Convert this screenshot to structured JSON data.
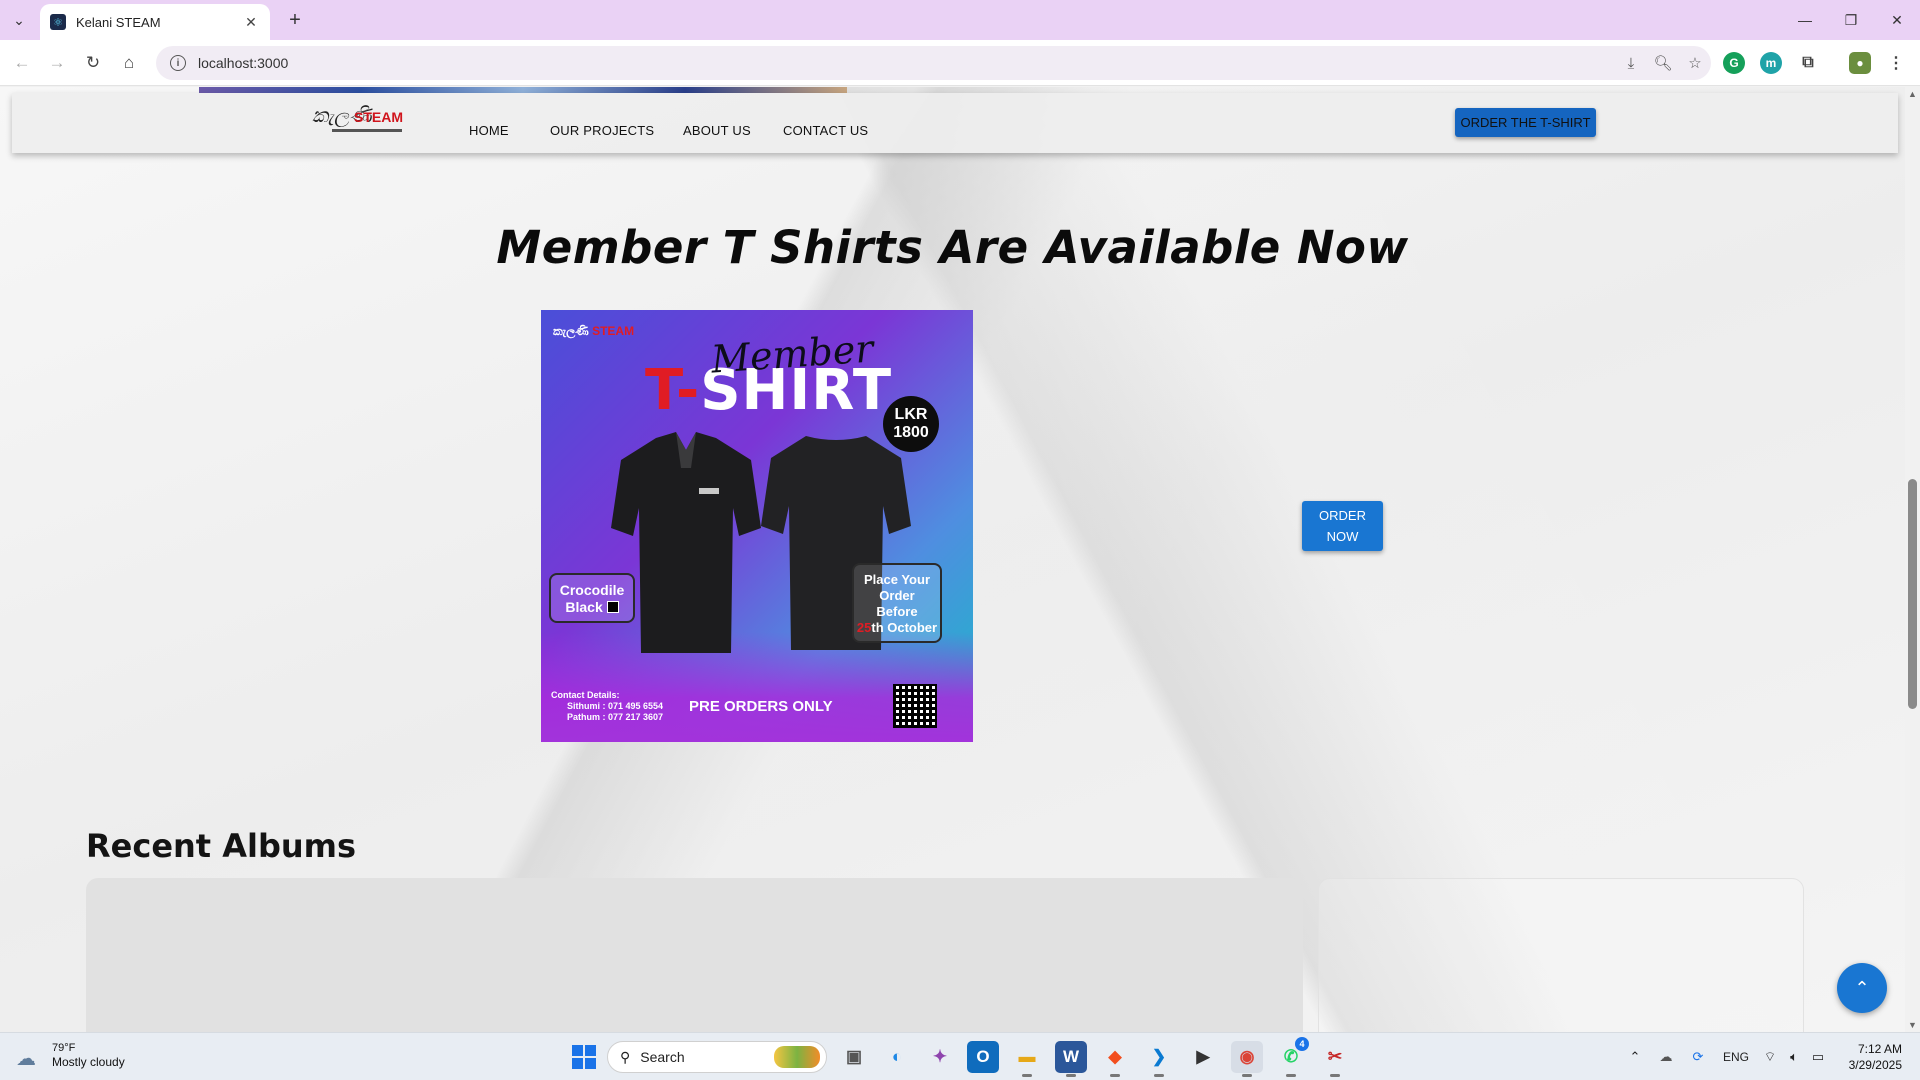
{
  "browser": {
    "tab_title": "Kelani STEAM",
    "tab_menu_icon": "chevron-down-icon",
    "new_tab_icon": "plus-icon",
    "tab_close_icon": "close-icon",
    "url": "localhost:3000",
    "window_controls": [
      "minimize",
      "restore",
      "close"
    ]
  },
  "site_nav": {
    "logo_script": "කැලණි",
    "logo_word": "STEAM",
    "links": [
      "HOME",
      "OUR PROJECTS",
      "ABOUT US",
      "CONTACT US"
    ],
    "order_button": "ORDER THE T-SHIRT"
  },
  "promo": {
    "title": "Member T Shirts Are Available Now",
    "order_button": "ORDER NOW",
    "poster": {
      "logo_script": "කැලණි",
      "logo_word": "STEAM",
      "member": "Member",
      "tshirt_prefix": "T-",
      "tshirt_word": "SHIRT",
      "price_line1": "LKR",
      "price_line2": "1800",
      "color_line1": "Crocodile",
      "color_line2": "Black",
      "deadline_line1": "Place Your",
      "deadline_line2": "Order",
      "deadline_line3": "Before",
      "deadline_day": "25",
      "deadline_suffix": "th October",
      "contact_heading": "Contact Details:",
      "contact_1": "Sithumi : 071 495 6554",
      "contact_2": "Pathum : 077 217 3607",
      "preorder": "PRE ORDERS ONLY"
    }
  },
  "albums": {
    "title": "Recent Albums"
  },
  "taskbar": {
    "weather_temp": "79°F",
    "weather_desc": "Mostly cloudy",
    "search_label": "Search",
    "language": "ENG",
    "time": "7:12 AM",
    "date": "3/29/2025",
    "whatsapp_badge": "4"
  }
}
